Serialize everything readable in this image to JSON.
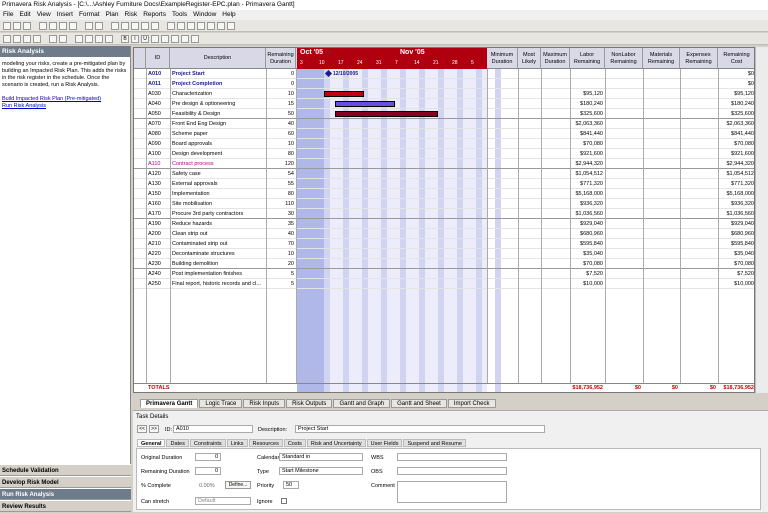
{
  "title": "Primavera Risk Analysis - [C:\\...\\Ashley Furniture Docs\\ExampleRegister-EPC.plan - Primavera Gantt]",
  "menu": [
    "File",
    "Edit",
    "View",
    "Insert",
    "Format",
    "Plan",
    "Risk",
    "Reports",
    "Tools",
    "Window",
    "Help"
  ],
  "left_panel": {
    "header": "Risk Analysis",
    "text": "modeling your risks, create a pre-mitigated plan by building an Impacted Risk Plan. This adds the risks in the risk register in the schedule. Once the scenario is created, run a Risk Analysis.",
    "link1": "Build Impacted Risk Plan (Pre-mitigated)",
    "link2": "Run Risk Analysis"
  },
  "workflow": [
    "Schedule Validation",
    "Develop Risk Model",
    "Run Risk Analysis",
    "Review Results"
  ],
  "columns": {
    "id": "ID",
    "desc": "Description",
    "dur": "Remaining Duration",
    "min": "Minimum Duration",
    "likely": "Most Likely",
    "max": "Maximum Duration",
    "labor": "Labor Remaining",
    "nonlabor": "NonLabor Remaining",
    "materials": "Materials Remaining",
    "expenses": "Expenses Remaining",
    "cost": "Remaining Cost"
  },
  "timescale": {
    "month1": "Oct '05",
    "month2": "Nov '05",
    "days": [
      "3",
      "10",
      "17",
      "24",
      "31",
      "7",
      "14",
      "21",
      "28",
      "5"
    ],
    "milestone_label": "12/10/2005"
  },
  "rows": [
    {
      "id": "A010",
      "desc": "Project Start",
      "dur": "0",
      "labor": "",
      "cost": "$0"
    },
    {
      "id": "A011",
      "desc": "Project Completion",
      "dur": "0",
      "labor": "",
      "cost": "$0"
    },
    {
      "id": "A030",
      "desc": "Characterization",
      "dur": "10",
      "labor": "$95,120",
      "cost": "$95,120"
    },
    {
      "id": "A040",
      "desc": "Pre design & optioneering",
      "dur": "15",
      "labor": "$180,240",
      "cost": "$180,240"
    },
    {
      "id": "A050",
      "desc": "Feasibility & Design",
      "dur": "50",
      "labor": "$325,600",
      "cost": "$325,600"
    },
    {
      "id": "A070",
      "desc": "Front End Eng Design",
      "dur": "40",
      "labor": "$2,063,360",
      "cost": "$2,063,360"
    },
    {
      "id": "A080",
      "desc": "Scheme paper",
      "dur": "60",
      "labor": "$841,440",
      "cost": "$841,440"
    },
    {
      "id": "A090",
      "desc": "Board approvals",
      "dur": "10",
      "labor": "$70,080",
      "cost": "$70,080"
    },
    {
      "id": "A100",
      "desc": "Design development",
      "dur": "80",
      "labor": "$921,600",
      "cost": "$921,600"
    },
    {
      "id": "A110",
      "desc": "Contract process",
      "dur": "120",
      "labor": "$2,944,320",
      "cost": "$2,944,320"
    },
    {
      "id": "A120",
      "desc": "Safety case",
      "dur": "54",
      "labor": "$1,054,512",
      "cost": "$1,054,512"
    },
    {
      "id": "A130",
      "desc": "External approvals",
      "dur": "55",
      "labor": "$771,320",
      "cost": "$771,320"
    },
    {
      "id": "A150",
      "desc": "Implementation",
      "dur": "80",
      "labor": "$5,168,000",
      "cost": "$5,168,000"
    },
    {
      "id": "A160",
      "desc": "Site mobilisation",
      "dur": "110",
      "labor": "$936,320",
      "cost": "$936,320"
    },
    {
      "id": "A170",
      "desc": "Procure 3rd party contractors",
      "dur": "30",
      "labor": "$1,036,560",
      "cost": "$1,036,560"
    },
    {
      "id": "A190",
      "desc": "Reduce hazards",
      "dur": "35",
      "labor": "$929,040",
      "cost": "$929,040"
    },
    {
      "id": "A200",
      "desc": "Clean strip out",
      "dur": "40",
      "labor": "$680,960",
      "cost": "$680,960"
    },
    {
      "id": "A210",
      "desc": "Contaminated strip out",
      "dur": "70",
      "labor": "$595,840",
      "cost": "$595,840"
    },
    {
      "id": "A220",
      "desc": "Decontaminate structures",
      "dur": "10",
      "labor": "$35,040",
      "cost": "$35,040"
    },
    {
      "id": "A230",
      "desc": "Building demolition",
      "dur": "20",
      "labor": "$70,080",
      "cost": "$70,080"
    },
    {
      "id": "A240",
      "desc": "Post implementation finishes",
      "dur": "5",
      "labor": "$7,520",
      "cost": "$7,520"
    },
    {
      "id": "A250",
      "desc": "Final report, historic records and cl...",
      "dur": "5",
      "labor": "$10,000",
      "cost": "$10,000"
    }
  ],
  "totals": {
    "label": "TOTALS",
    "labor": "$18,736,952",
    "nonlabor": "$0",
    "materials": "$0",
    "expenses": "$0",
    "cost": "$18,736,952"
  },
  "view_tabs": [
    "Primavera Gantt",
    "Logic Trace",
    "Risk Inputs",
    "Risk Outputs",
    "Gantt and Graph",
    "Gantt and Sheet",
    "Import Check"
  ],
  "details": {
    "title": "Task Details",
    "id_label": "ID:",
    "id_value": "A010",
    "desc_label": "Description:",
    "desc_value": "Project Start",
    "tabs": [
      "General",
      "Dates",
      "Constraints",
      "Links",
      "Resources",
      "Costs",
      "Risk and Uncertainty",
      "User Fields",
      "Suspend and Resume"
    ],
    "original_duration_label": "Original Duration",
    "original_duration": "0",
    "remaining_duration_label": "Remaining Duration",
    "remaining_duration": "0",
    "pct_label": "% Complete",
    "pct_value": "0.00%",
    "define": "Define...",
    "can_stretch_label": "Can stretch",
    "can_stretch": "Default",
    "calendar_label": "Calendar",
    "calendar": "Standard in",
    "type_label": "Type",
    "type": "Start Milestone",
    "priority_label": "Priority",
    "priority": "50",
    "ignore_label": "Ignore",
    "wbs_label": "WBS",
    "obs_label": "OBS",
    "comment_label": "Comment"
  }
}
